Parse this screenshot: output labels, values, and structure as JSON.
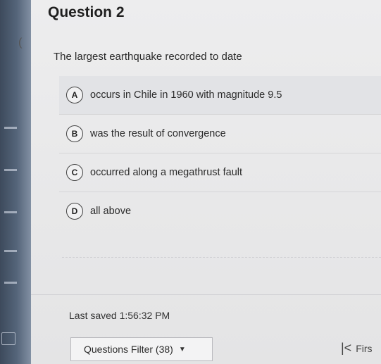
{
  "question": {
    "heading": "Question 2",
    "prompt": "The largest earthquake recorded to date",
    "options": [
      {
        "letter": "A",
        "text": "occurs in Chile in 1960 with magnitude 9.5"
      },
      {
        "letter": "B",
        "text": "was the result of convergence"
      },
      {
        "letter": "C",
        "text": "occurred along a megathrust fault"
      },
      {
        "letter": "D",
        "text": "all above"
      }
    ]
  },
  "status": {
    "last_saved": "Last saved 1:56:32 PM"
  },
  "footer": {
    "filter_label": "Questions Filter (38)",
    "filter_caret": "▼",
    "first_label": "Firs",
    "first_icon": "|<"
  },
  "icons": {
    "collapse": "chevron-left-icon",
    "first": "first-page-icon"
  }
}
